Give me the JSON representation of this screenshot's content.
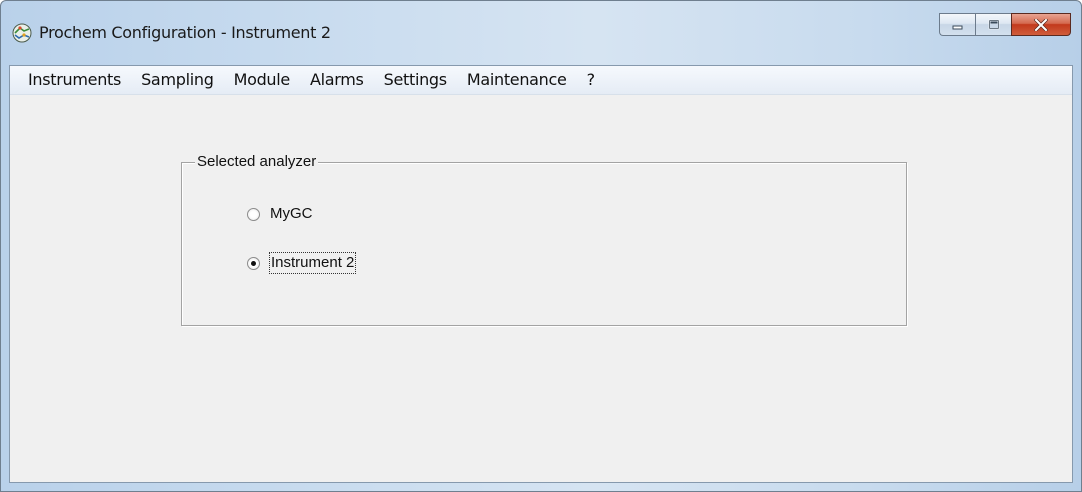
{
  "window": {
    "title": "Prochem Configuration - Instrument 2",
    "icon": "prochem-app-icon"
  },
  "menu": {
    "items": [
      "Instruments",
      "Sampling",
      "Module",
      "Alarms",
      "Settings",
      "Maintenance",
      "?"
    ]
  },
  "selected_analyzer": {
    "label": "Selected analyzer",
    "options": [
      {
        "label": "MyGC",
        "checked": false
      },
      {
        "label": "Instrument 2",
        "checked": true
      }
    ]
  }
}
